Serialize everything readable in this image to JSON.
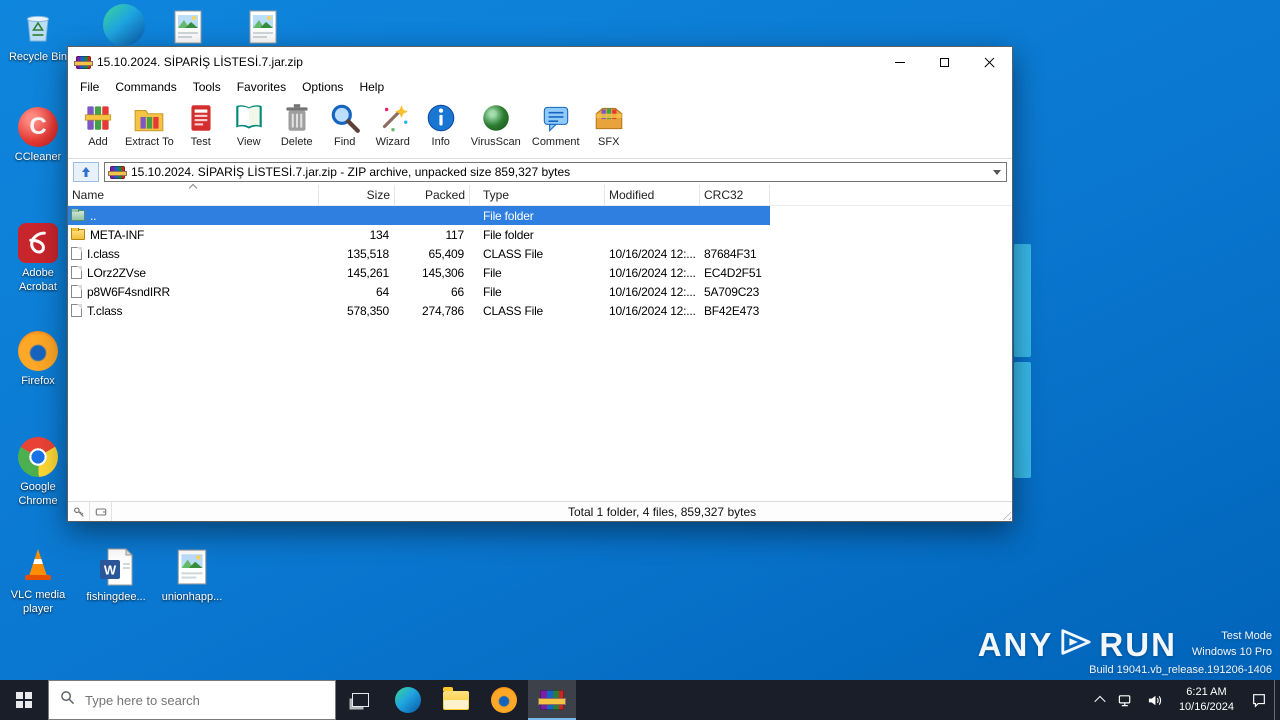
{
  "desktop": {
    "icons": [
      {
        "label": "Recycle Bin"
      },
      {
        "label": "CCleaner"
      },
      {
        "label": "Adobe Acrobat"
      },
      {
        "label": "Firefox"
      },
      {
        "label": "Google Chrome"
      },
      {
        "label": "VLC media player"
      },
      {
        "label": "fishingdee..."
      },
      {
        "label": "unionhapp..."
      }
    ],
    "watermark": {
      "any": "ANY",
      "run": "RUN",
      "test_mode": "Test Mode",
      "os": "Windows 10 Pro",
      "build": "Build 19041.vb_release.191206-1406"
    }
  },
  "winrar": {
    "title": "15.10.2024. SİPARİŞ LİSTESİ.7.jar.zip",
    "menu": [
      {
        "label": "File"
      },
      {
        "label": "Commands"
      },
      {
        "label": "Tools"
      },
      {
        "label": "Favorites"
      },
      {
        "label": "Options"
      },
      {
        "label": "Help"
      }
    ],
    "toolbar": [
      {
        "label": "Add"
      },
      {
        "label": "Extract To"
      },
      {
        "label": "Test"
      },
      {
        "label": "View"
      },
      {
        "label": "Delete"
      },
      {
        "label": "Find"
      },
      {
        "label": "Wizard"
      },
      {
        "label": "Info"
      },
      {
        "label": "VirusScan"
      },
      {
        "label": "Comment"
      },
      {
        "label": "SFX"
      }
    ],
    "address": "15.10.2024. SİPARİŞ LİSTESİ.7.jar.zip - ZIP archive, unpacked size 859,327 bytes",
    "columns": [
      {
        "label": "Name"
      },
      {
        "label": "Size"
      },
      {
        "label": "Packed"
      },
      {
        "label": "Type"
      },
      {
        "label": "Modified"
      },
      {
        "label": "CRC32"
      }
    ],
    "rows": [
      {
        "name": "..",
        "size": "",
        "packed": "",
        "type": "File folder",
        "modified": "",
        "crc32": ""
      },
      {
        "name": "META-INF",
        "size": "134",
        "packed": "117",
        "type": "File folder",
        "modified": "",
        "crc32": ""
      },
      {
        "name": "I.class",
        "size": "135,518",
        "packed": "65,409",
        "type": "CLASS File",
        "modified": "10/16/2024 12:...",
        "crc32": "87684F31"
      },
      {
        "name": "LOrz2ZVse",
        "size": "145,261",
        "packed": "145,306",
        "type": "File",
        "modified": "10/16/2024 12:...",
        "crc32": "EC4D2F51"
      },
      {
        "name": "p8W6F4sndIRR",
        "size": "64",
        "packed": "66",
        "type": "File",
        "modified": "10/16/2024 12:...",
        "crc32": "5A709C23"
      },
      {
        "name": "T.class",
        "size": "578,350",
        "packed": "274,786",
        "type": "CLASS File",
        "modified": "10/16/2024 12:...",
        "crc32": "BF42E473"
      }
    ],
    "status": "Total 1 folder, 4 files, 859,327 bytes"
  },
  "taskbar": {
    "search_placeholder": "Type here to search",
    "clock": {
      "time": "6:21 AM",
      "date": "10/16/2024"
    }
  }
}
